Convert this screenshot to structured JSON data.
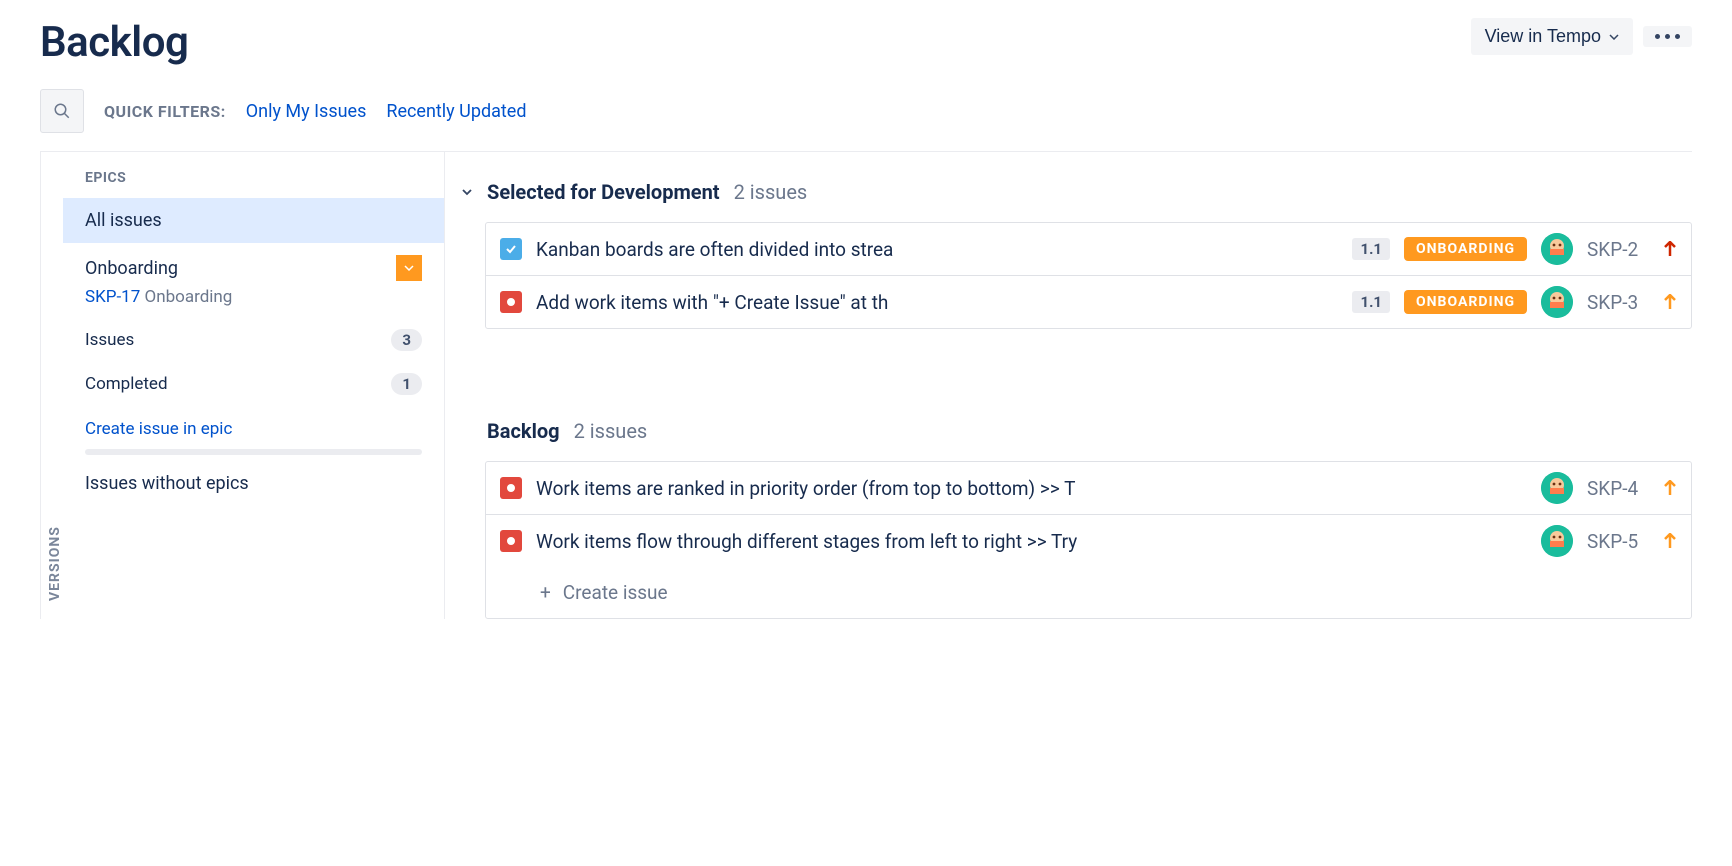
{
  "header": {
    "title": "Backlog",
    "tempo_label": "View in Tempo"
  },
  "filters": {
    "label": "QUICK FILTERS:",
    "only_my": "Only My Issues",
    "recent": "Recently Updated"
  },
  "versions_tab": "VERSIONS",
  "epics": {
    "header": "EPICS",
    "all_label": "All issues",
    "card": {
      "name": "Onboarding",
      "key": "SKP-17",
      "summary": "Onboarding",
      "issues_label": "Issues",
      "issues_count": "3",
      "completed_label": "Completed",
      "completed_count": "1",
      "create_label": "Create issue in epic"
    },
    "no_epics_label": "Issues without epics"
  },
  "sections": {
    "selected": {
      "title": "Selected for Development",
      "count": "2 issues",
      "issues": [
        {
          "summary": "Kanban boards are often divided into strea",
          "version": "1.1",
          "epic": "ONBOARDING",
          "key": "SKP-2",
          "priority": "high",
          "type": "task"
        },
        {
          "summary": "Add work items with \"+ Create Issue\" at th",
          "version": "1.1",
          "epic": "ONBOARDING",
          "key": "SKP-3",
          "priority": "medium",
          "type": "story"
        }
      ]
    },
    "backlog": {
      "title": "Backlog",
      "count": "2 issues",
      "issues": [
        {
          "summary": "Work items are ranked in priority order (from top to bottom) >> T",
          "key": "SKP-4",
          "priority": "medium",
          "type": "story"
        },
        {
          "summary": "Work items flow through different stages from left to right >> Try",
          "key": "SKP-5",
          "priority": "medium",
          "type": "story"
        }
      ],
      "create_label": "Create issue"
    }
  }
}
